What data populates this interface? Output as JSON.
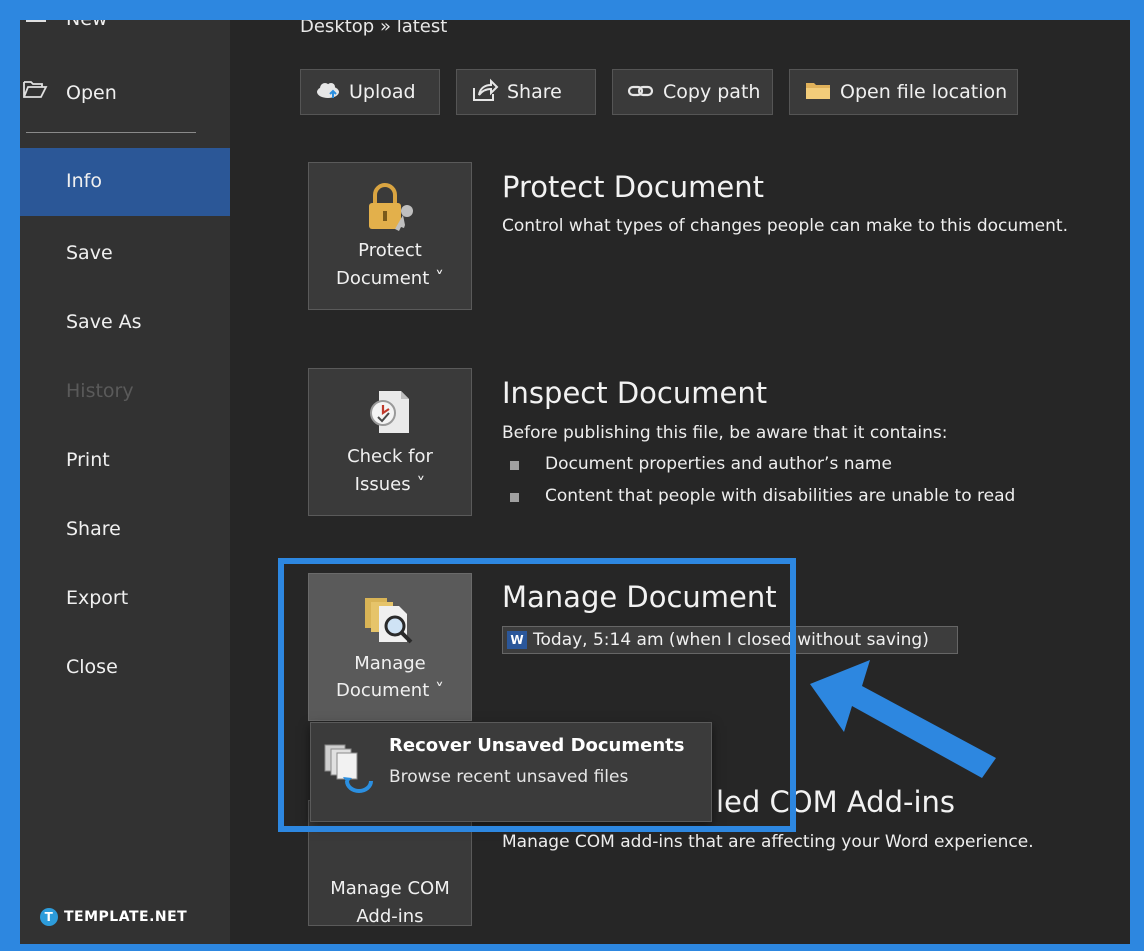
{
  "sidebar": {
    "items": [
      {
        "label": "New"
      },
      {
        "label": "Open"
      },
      {
        "label": "Info"
      },
      {
        "label": "Save"
      },
      {
        "label": "Save As"
      },
      {
        "label": "History"
      },
      {
        "label": "Print"
      },
      {
        "label": "Share"
      },
      {
        "label": "Export"
      },
      {
        "label": "Close"
      }
    ],
    "active": "Info"
  },
  "breadcrumb": "Desktop » latest",
  "toolbar": {
    "upload_label": "Upload",
    "share_label": "Share",
    "copy_path_label": "Copy path",
    "open_location_label": "Open file location"
  },
  "protect": {
    "button_line1": "Protect",
    "button_line2": "Document ˅",
    "title": "Protect Document",
    "description": "Control what types of changes people can make to this document."
  },
  "inspect": {
    "button_line1": "Check for",
    "button_line2": "Issues ˅",
    "title": "Inspect Document",
    "description": "Before publishing this file, be aware that it contains:",
    "bullets": [
      "Document properties and author’s name",
      "Content that people with disabilities are unable to read"
    ]
  },
  "manage": {
    "button_line1": "Manage",
    "button_line2": "Document ˅",
    "title": "Manage Document",
    "version_entry": "Today, 5:14 am (when I closed without saving)"
  },
  "dropdown": {
    "title": "Recover Unsaved Documents",
    "description": "Browse recent unsaved files"
  },
  "com": {
    "button_line1": "Manage COM",
    "button_line2": "Add-ins",
    "title": "Slow and Disabled COM Add-ins",
    "title_visible": "led COM Add-ins",
    "description": "Manage COM add-ins that are affecting your Word experience."
  },
  "watermark": {
    "mark": "T",
    "text": "TEMPLATE.NET"
  },
  "colors": {
    "highlight": "#2d87e0",
    "active_nav": "#2b5797",
    "background": "#262626"
  }
}
